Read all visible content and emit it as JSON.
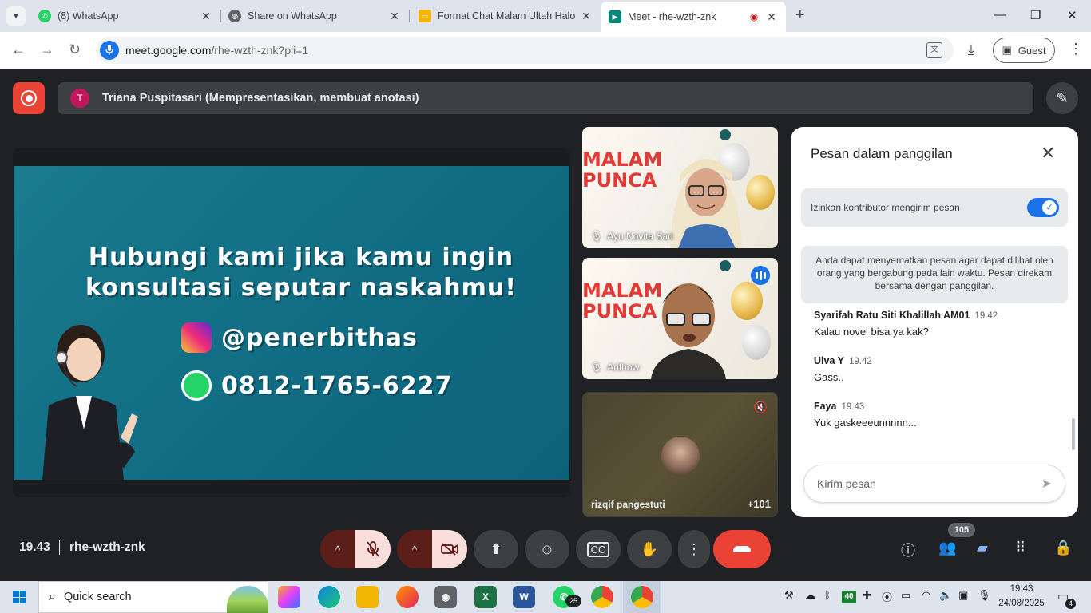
{
  "browser": {
    "tabs": [
      {
        "title": "(8) WhatsApp",
        "favicon": "whatsapp-icon",
        "color": "#25d366"
      },
      {
        "title": "Share on WhatsApp",
        "favicon": "globe-icon",
        "color": "#5f6368"
      },
      {
        "title": "Format Chat Malam Ultah Halo",
        "favicon": "slides-icon",
        "color": "#f4b400"
      },
      {
        "title": "Meet - rhe-wzth-znk",
        "favicon": "meet-icon",
        "color": "#00897b",
        "active": true
      }
    ],
    "url_host": "meet.google.com",
    "url_path": "/rhe-wzth-znk?pli=1",
    "profile_label": "Guest"
  },
  "meet": {
    "presenter_initial": "T",
    "presenter_label": "Triana Puspitasari (Mempresentasikan, membuat anotasi)",
    "slide": {
      "headline_line1": "Hubungi kami jika kamu ingin",
      "headline_line2": "konsultasi seputar naskahmu!",
      "instagram_handle": "@penerbithas",
      "whatsapp_number": "0812-1765-6227"
    },
    "tiles": [
      {
        "name": "Ayu Novita Sari",
        "poster_line1": "MALAM",
        "poster_line2": "PUNCA"
      },
      {
        "name": "Arifhow",
        "poster_line1": "MALAM",
        "poster_line2": "PUNCA"
      },
      {
        "name": "rizqif pangestuti",
        "more_count": "+101"
      }
    ],
    "chat": {
      "title": "Pesan dalam panggilan",
      "permission_label": "Izinkan kontributor mengirim pesan",
      "permission_on": true,
      "info_text": "Anda dapat menyematkan pesan agar dapat dilihat oleh orang yang bergabung pada lain waktu. Pesan direkam bersama dengan panggilan.",
      "messages": [
        {
          "sender": "Syarifah Ratu Siti Khalillah AM01",
          "time": "19.42",
          "text": "Kalau novel bisa ya kak?"
        },
        {
          "sender": "Ulva Y",
          "time": "19.42",
          "text": "Gass.."
        },
        {
          "sender": "Faya",
          "time": "19.43",
          "text": "Yuk gaskeeeunnnnn..."
        }
      ],
      "input_placeholder": "Kirim pesan"
    },
    "time": "19.43",
    "meeting_code": "rhe-wzth-znk",
    "participant_count": "105"
  },
  "taskbar": {
    "search_placeholder": "Quick search",
    "whatsapp_badge": "25",
    "tray_badge": "40",
    "time": "19:43",
    "date": "24/08/2025",
    "notification_count": "4"
  }
}
